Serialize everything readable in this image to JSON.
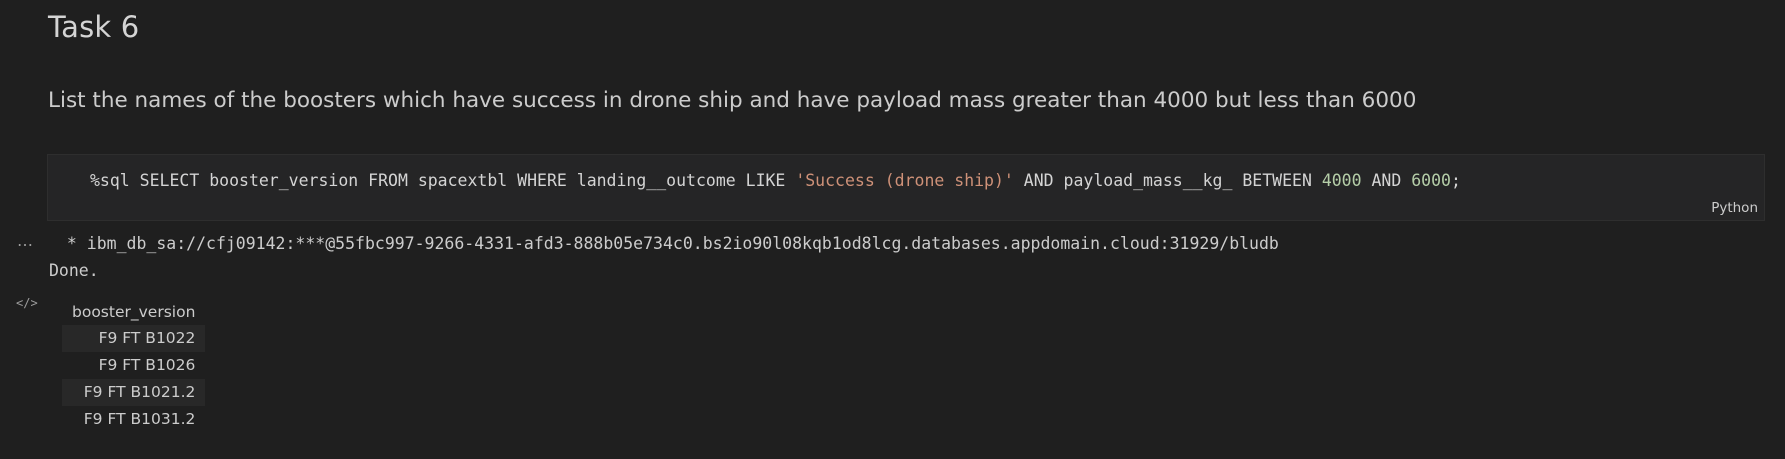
{
  "markdown": {
    "title": "Task 6",
    "description": "List the names of the boosters which have success in drone ship and have payload mass greater than 4000 but less than 6000"
  },
  "code_cell": {
    "code_prefix": "%sql SELECT booster_version FROM spacextbl WHERE landing__outcome LIKE ",
    "code_string": "'Success (drone ship)'",
    "code_mid": " AND payload_mass__kg_ BETWEEN ",
    "code_num1": "4000",
    "code_and": " AND ",
    "code_num2": "6000",
    "code_suffix": ";",
    "language": "Python"
  },
  "output": {
    "menu_icon": "ellipsis-icon",
    "connection_line": " * ibm_db_sa://cfj09142:***@55fbc997-9266-4331-afd3-888b05e734c0.bs2io90l08kqb1od8lcg.databases.appdomain.cloud:31929/bludb",
    "status_line": "Done.",
    "html_icon": "code-icon",
    "table": {
      "header": "booster_version",
      "rows": [
        "F9 FT B1022",
        "F9 FT B1026",
        "F9 FT B1021.2",
        "F9 FT B1031.2"
      ]
    }
  }
}
